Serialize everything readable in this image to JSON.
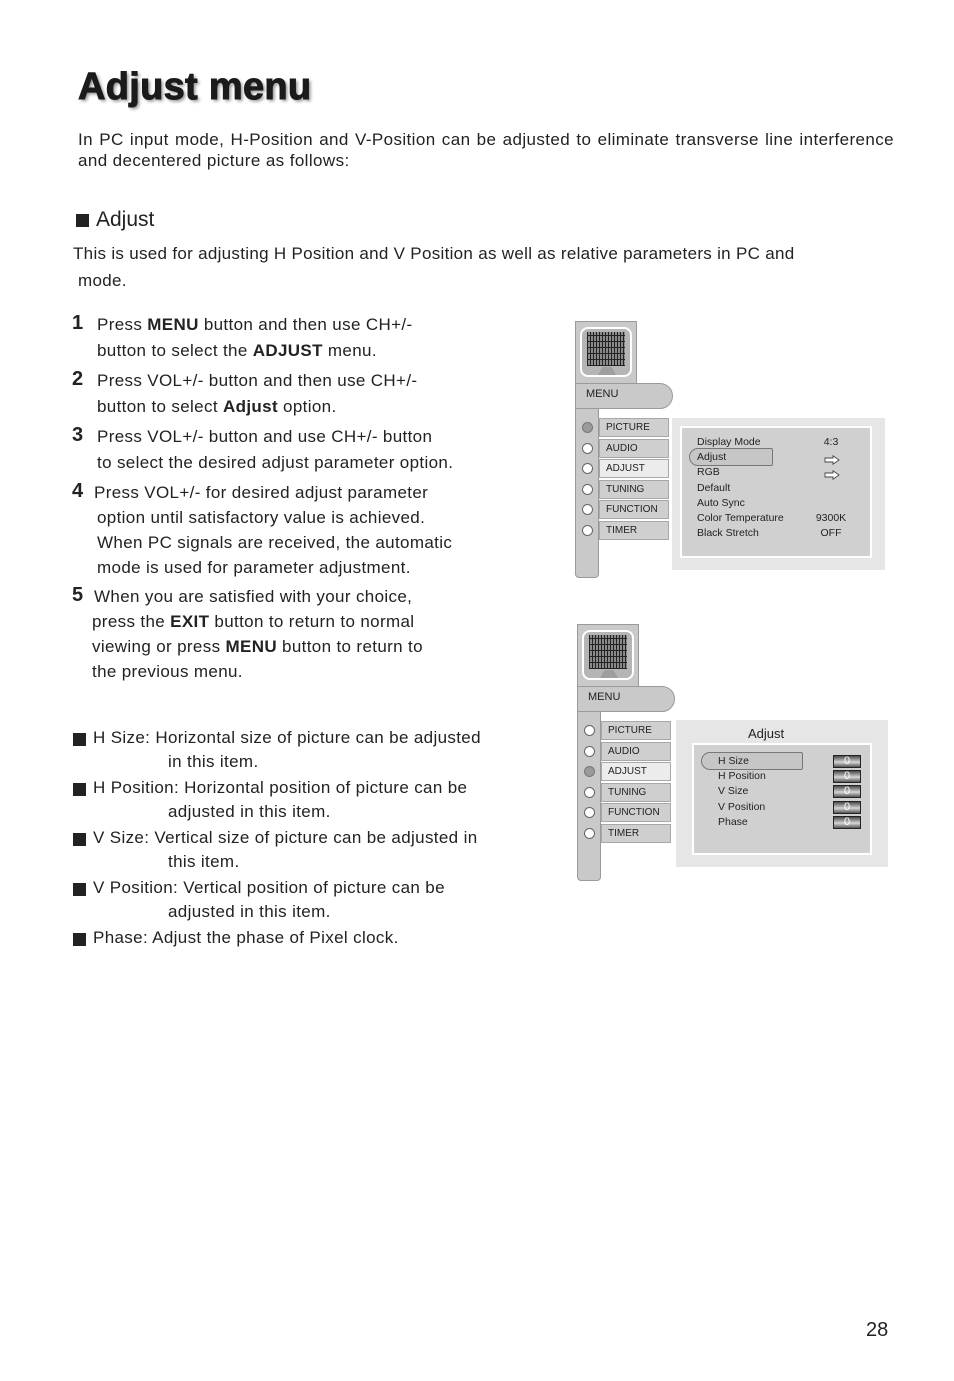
{
  "title": "Adjust menu",
  "intro": "In PC input mode, H-Position and V-Position can be adjusted to eliminate transverse line interference and decentered picture as follows:",
  "section": {
    "heading": "Adjust",
    "desc_line1": "This is used for adjusting H Position and V Position as well as relative parameters in PC and",
    "desc_line2": "mode."
  },
  "steps": [
    {
      "num": "1",
      "lines": [
        {
          "pre": "Press ",
          "bold": "MENU",
          "post": " button and then use CH+/-"
        },
        {
          "pre": "button to select the ",
          "bold": "ADJUST",
          "post": " menu."
        }
      ]
    },
    {
      "num": "2",
      "lines": [
        {
          "pre": "Press VOL+/- button and then use CH+/-",
          "bold": "",
          "post": ""
        },
        {
          "pre": "button to select ",
          "bold": "Adjust",
          "post": " option."
        }
      ]
    },
    {
      "num": "3",
      "lines": [
        {
          "pre": "Press VOL+/- button and use CH+/- button",
          "bold": "",
          "post": ""
        },
        {
          "pre": "to select the desired adjust parameter option.",
          "bold": "",
          "post": ""
        }
      ]
    },
    {
      "num": "4",
      "lines": [
        {
          "pre": "Press VOL+/- for desired adjust parameter",
          "bold": "",
          "post": ""
        },
        {
          "pre": "option until satisfactory value is achieved.",
          "bold": "",
          "post": ""
        },
        {
          "pre": "When PC signals are received, the automatic",
          "bold": "",
          "post": ""
        },
        {
          "pre": " mode is used for parameter adjustment.",
          "bold": "",
          "post": ""
        }
      ]
    },
    {
      "num": "5",
      "lines": [
        {
          "pre": "When you are satisfied with your choice,",
          "bold": "",
          "post": ""
        },
        {
          "pre": "press the ",
          "bold": "EXIT",
          "post": " button to return to normal"
        },
        {
          "pre": "viewing or press ",
          "bold": "MENU",
          "post": " button to return to"
        },
        {
          "pre": "the previous menu.",
          "bold": "",
          "post": ""
        }
      ]
    }
  ],
  "bullets": [
    {
      "text": "H Size:  Horizontal size of picture can be adjusted",
      "cont": "in this item."
    },
    {
      "text": "H Position: Horizontal position of picture can be",
      "cont": "adjusted in this item."
    },
    {
      "text": "V Size: Vertical size of picture can be adjusted in",
      "cont": "this item."
    },
    {
      "text": "V Position: Vertical position of picture can be",
      "cont": "adjusted in this item."
    },
    {
      "text": "Phase: Adjust the phase of Pixel clock.",
      "cont": ""
    }
  ],
  "osd1": {
    "menu_label": "MENU",
    "items": [
      "PICTURE",
      "AUDIO",
      "ADJUST",
      "TUNING",
      "FUNCTION",
      "TIMER"
    ],
    "selected_radio": 0,
    "active_item": 2,
    "rows": [
      {
        "label": "Display Mode",
        "value": "4:3"
      },
      {
        "label": "Adjust",
        "value": "arrow-right-icon"
      },
      {
        "label": "RGB",
        "value": "arrow-right-icon"
      },
      {
        "label": "Default",
        "value": ""
      },
      {
        "label": "Auto Sync",
        "value": ""
      },
      {
        "label": "Color Temperature",
        "value": "9300K"
      },
      {
        "label": "Black Stretch",
        "value": "OFF"
      }
    ],
    "highlighted_row": 1
  },
  "osd2": {
    "menu_label": "MENU",
    "items": [
      "PICTURE",
      "AUDIO",
      "ADJUST",
      "TUNING",
      "FUNCTION",
      "TIMER"
    ],
    "selected_radio": 2,
    "active_item": 2,
    "panel_title": "Adjust",
    "rows": [
      {
        "label": "H Size",
        "value": "0"
      },
      {
        "label": "H Position",
        "value": "0"
      },
      {
        "label": "V Size",
        "value": "0"
      },
      {
        "label": "V Position",
        "value": "0"
      },
      {
        "label": "Phase",
        "value": "0"
      }
    ],
    "highlighted_row": 0
  },
  "page_number": "28"
}
